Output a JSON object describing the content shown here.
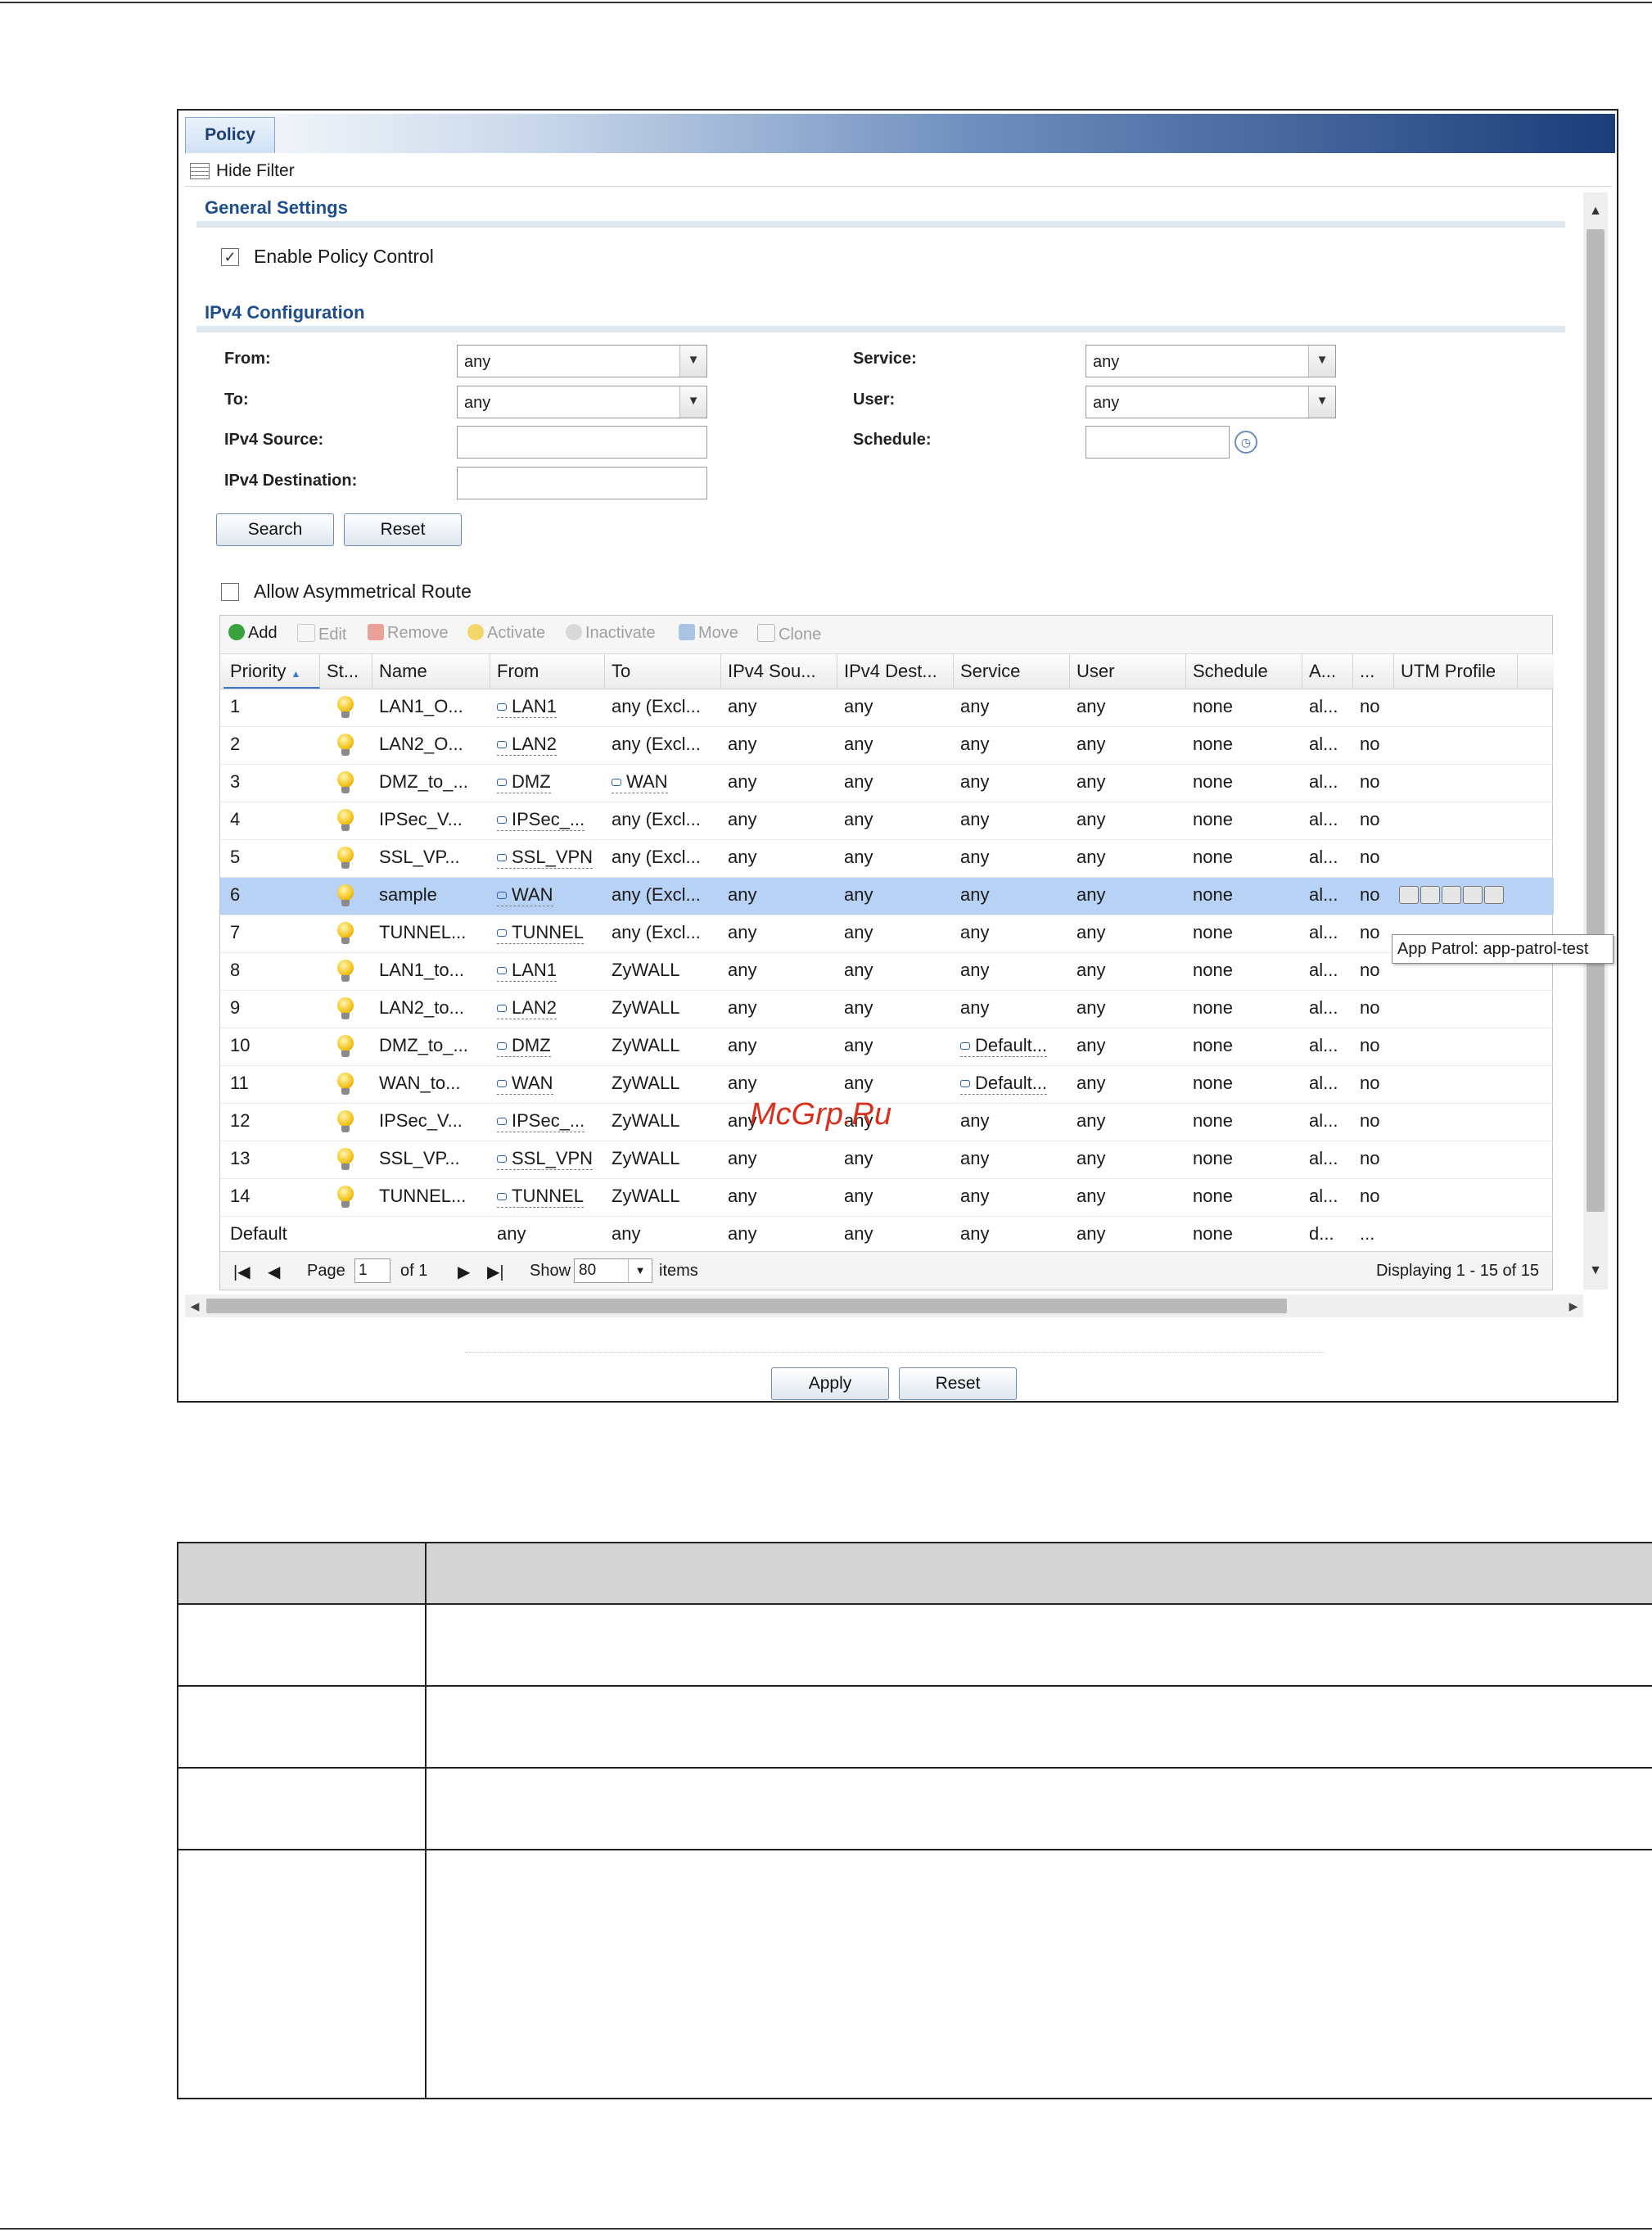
{
  "window": {
    "tab_label": "Policy",
    "hide_filter_label": "Hide Filter"
  },
  "general_settings": {
    "title": "General Settings",
    "enable_policy_control": "Enable Policy Control",
    "enable_checked": true
  },
  "ipv4_config": {
    "title": "IPv4 Configuration",
    "from_label": "From:",
    "from_value": "any",
    "to_label": "To:",
    "to_value": "any",
    "ipv4_source_label": "IPv4 Source:",
    "ipv4_destination_label": "IPv4 Destination:",
    "service_label": "Service:",
    "service_value": "any",
    "user_label": "User:",
    "user_value": "any",
    "schedule_label": "Schedule:",
    "search_label": "Search",
    "reset_label": "Reset"
  },
  "asym_route": {
    "label": "Allow Asymmetrical Route",
    "checked": false
  },
  "toolbar": {
    "add": "Add",
    "edit": "Edit",
    "remove": "Remove",
    "activate": "Activate",
    "inactivate": "Inactivate",
    "move": "Move",
    "clone": "Clone"
  },
  "columns": [
    "Priority",
    "St...",
    "Name",
    "From",
    "To",
    "IPv4 Sou...",
    "IPv4 Dest...",
    "Service",
    "User",
    "Schedule",
    "A...",
    "...",
    "UTM Profile"
  ],
  "sort_indicator": "▲",
  "rows": [
    {
      "priority": "1",
      "name": "LAN1_O...",
      "from": "LAN1",
      "to": "any (Excl...",
      "src": "any",
      "dst": "any",
      "service": "any",
      "user": "any",
      "schedule": "none",
      "a": "al...",
      "x": "no"
    },
    {
      "priority": "2",
      "name": "LAN2_O...",
      "from": "LAN2",
      "to": "any (Excl...",
      "src": "any",
      "dst": "any",
      "service": "any",
      "user": "any",
      "schedule": "none",
      "a": "al...",
      "x": "no"
    },
    {
      "priority": "3",
      "name": "DMZ_to_...",
      "from": "DMZ",
      "to": "WAN",
      "src": "any",
      "dst": "any",
      "service": "any",
      "user": "any",
      "schedule": "none",
      "a": "al...",
      "x": "no"
    },
    {
      "priority": "4",
      "name": "IPSec_V...",
      "from": "IPSec_...",
      "to": "any (Excl...",
      "src": "any",
      "dst": "any",
      "service": "any",
      "user": "any",
      "schedule": "none",
      "a": "al...",
      "x": "no"
    },
    {
      "priority": "5",
      "name": "SSL_VP...",
      "from": "SSL_VPN",
      "to": "any (Excl...",
      "src": "any",
      "dst": "any",
      "service": "any",
      "user": "any",
      "schedule": "none",
      "a": "al...",
      "x": "no"
    },
    {
      "priority": "6",
      "name": "sample",
      "from": "WAN",
      "to": "any (Excl...",
      "src": "any",
      "dst": "any",
      "service": "any",
      "user": "any",
      "schedule": "none",
      "a": "al...",
      "x": "no"
    },
    {
      "priority": "7",
      "name": "TUNNEL...",
      "from": "TUNNEL",
      "to": "any (Excl...",
      "src": "any",
      "dst": "any",
      "service": "any",
      "user": "any",
      "schedule": "none",
      "a": "al...",
      "x": "no"
    },
    {
      "priority": "8",
      "name": "LAN1_to...",
      "from": "LAN1",
      "to": "ZyWALL",
      "src": "any",
      "dst": "any",
      "service": "any",
      "user": "any",
      "schedule": "none",
      "a": "al...",
      "x": "no"
    },
    {
      "priority": "9",
      "name": "LAN2_to...",
      "from": "LAN2",
      "to": "ZyWALL",
      "src": "any",
      "dst": "any",
      "service": "any",
      "user": "any",
      "schedule": "none",
      "a": "al...",
      "x": "no"
    },
    {
      "priority": "10",
      "name": "DMZ_to_...",
      "from": "DMZ",
      "to": "ZyWALL",
      "src": "any",
      "dst": "any",
      "service": "Default...",
      "user": "any",
      "schedule": "none",
      "a": "al...",
      "x": "no"
    },
    {
      "priority": "11",
      "name": "WAN_to...",
      "from": "WAN",
      "to": "ZyWALL",
      "src": "any",
      "dst": "any",
      "service": "Default...",
      "user": "any",
      "schedule": "none",
      "a": "al...",
      "x": "no"
    },
    {
      "priority": "12",
      "name": "IPSec_V...",
      "from": "IPSec_...",
      "to": "ZyWALL",
      "src": "any",
      "dst": "any",
      "service": "any",
      "user": "any",
      "schedule": "none",
      "a": "al...",
      "x": "no"
    },
    {
      "priority": "13",
      "name": "SSL_VP...",
      "from": "SSL_VPN",
      "to": "ZyWALL",
      "src": "any",
      "dst": "any",
      "service": "any",
      "user": "any",
      "schedule": "none",
      "a": "al...",
      "x": "no"
    },
    {
      "priority": "14",
      "name": "TUNNEL...",
      "from": "TUNNEL",
      "to": "ZyWALL",
      "src": "any",
      "dst": "any",
      "service": "any",
      "user": "any",
      "schedule": "none",
      "a": "al...",
      "x": "no"
    },
    {
      "priority": "Default",
      "name": "",
      "from": "any",
      "to": "any",
      "src": "any",
      "dst": "any",
      "service": "any",
      "user": "any",
      "schedule": "none",
      "a": "d...",
      "x": "..."
    }
  ],
  "selected_row": 5,
  "pager": {
    "page_label": "Page",
    "page_value": "1",
    "of_label": "of 1",
    "show_label": "Show",
    "show_value": "80",
    "items_label": "items",
    "displaying": "Displaying 1 - 15 of 15"
  },
  "footer": {
    "apply_label": "Apply",
    "reset_label": "Reset"
  },
  "tooltip": "App Patrol: app-patrol-test",
  "watermark": "McGrp.Ru",
  "colors": {
    "accent": "#1f4e8c",
    "selected_row": "#b7d2f4",
    "tab_gradient_end": "#1d3d7a"
  }
}
